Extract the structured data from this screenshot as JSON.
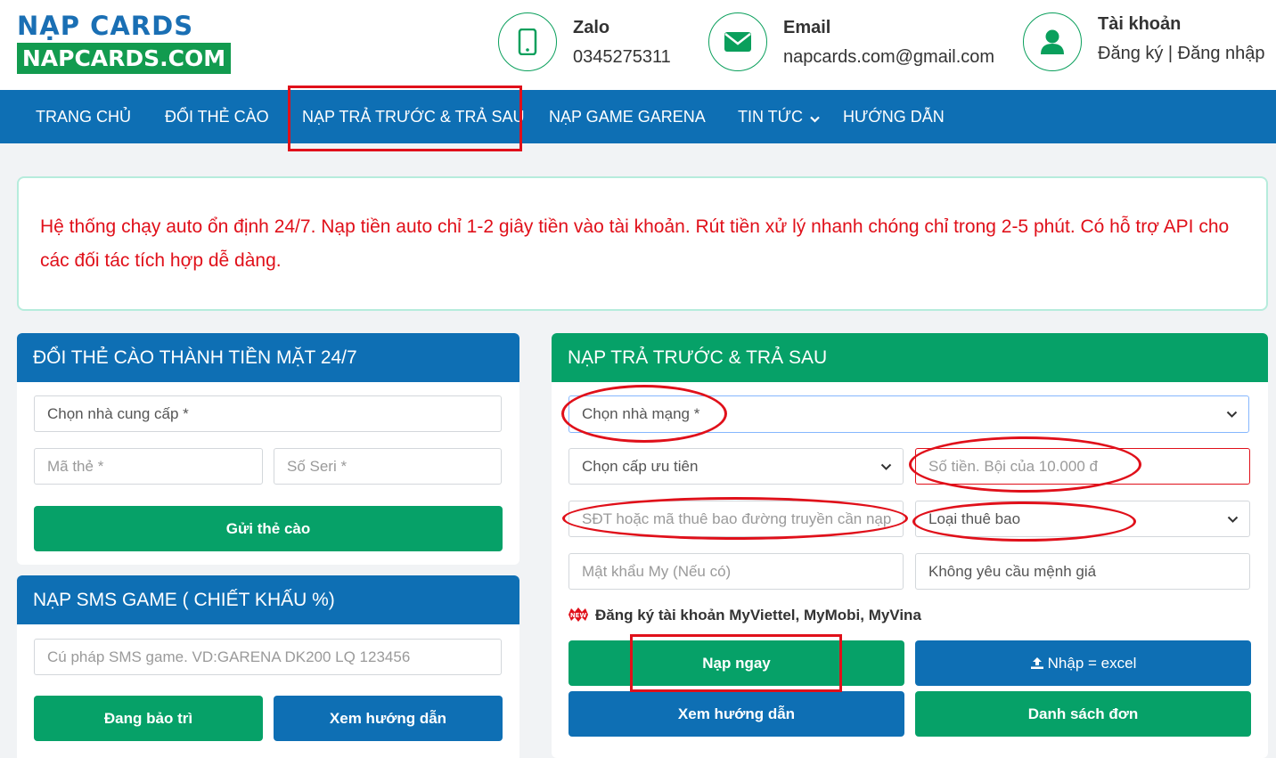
{
  "logo": {
    "top": "NẠP CARDS",
    "bottom": "NAPCARDS.COM"
  },
  "contacts": [
    {
      "title": "Zalo",
      "value": "0345275311",
      "icon": "phone-icon"
    },
    {
      "title": "Email",
      "value": "napcards.com@gmail.com",
      "icon": "envelope-icon"
    },
    {
      "title": "Tài khoản",
      "value": "Đăng ký | Đăng nhập",
      "icon": "user-icon"
    }
  ],
  "nav": {
    "home": "TRANG CHỦ",
    "exchange": "ĐỔI THẺ CÀO",
    "topup": "NẠP TRẢ TRƯỚC & TRẢ SAU",
    "garena": "NẠP GAME GARENA",
    "news": "TIN TỨC",
    "guide": "HƯỚNG DẪN"
  },
  "notice": "Hệ thống chạy auto ổn định 24/7. Nạp tiền auto chỉ 1-2 giây tiền vào tài khoản. Rút tiền xử lý nhanh chóng chỉ trong 2-5 phút. Có hỗ trợ API cho các đối tác tích hợp dễ dàng.",
  "card_panel": {
    "title": "ĐỔI THẺ CÀO THÀNH TIỀN MẶT 24/7",
    "provider": "Chọn nhà cung cấp *",
    "code_placeholder": "Mã thẻ *",
    "serial_placeholder": "Số Seri *",
    "submit": "Gửi thẻ cào"
  },
  "sms_panel": {
    "title": "NẠP SMS GAME ( CHIẾT KHẤU %)",
    "syntax_placeholder": "Cú pháp SMS game. VD:GARENA DK200 LQ 123456",
    "maintenance": "Đang bảo trì",
    "guide": "Xem hướng dẫn"
  },
  "topup_panel": {
    "title": "NẠP TRẢ TRƯỚC & TRẢ SAU",
    "network": "Chọn nhà mạng *",
    "priority": "Chọn cấp ưu tiên",
    "amount_placeholder": "Số tiền. Bội của 10.000 đ",
    "phone_placeholder": "SĐT hoặc mã thuê bao đường truyền cần nạp",
    "subscriber_type": "Loại thuê bao",
    "my_password_placeholder": "Mật khẩu My (Nếu có)",
    "denomination": "Không yêu cầu mệnh giá",
    "register_note": "Đăng ký tài khoản MyViettel, MyMobi, MyVina",
    "submit": "Nạp ngay",
    "excel": "Nhập = excel",
    "guide": "Xem hướng dẫn",
    "orders": "Danh sách đơn"
  },
  "colors": {
    "blue": "#0e6fb4",
    "green": "#06a168",
    "annotation_red": "#e0101a"
  }
}
